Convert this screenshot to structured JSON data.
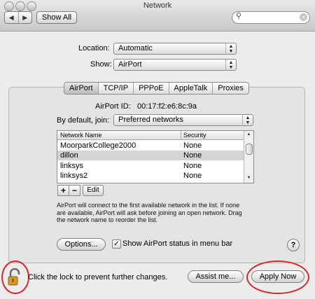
{
  "window": {
    "title": "Network"
  },
  "toolbar": {
    "back_fwd": [
      "◀",
      "▶"
    ],
    "show_all": "Show All",
    "search_placeholder": ""
  },
  "location": {
    "label": "Location:",
    "value": "Automatic"
  },
  "show": {
    "label": "Show:",
    "value": "AirPort"
  },
  "tabs": [
    "AirPort",
    "TCP/IP",
    "PPPoE",
    "AppleTalk",
    "Proxies"
  ],
  "airport": {
    "id_label": "AirPort ID:",
    "id_value": "00:17:f2:e6:8c:9a",
    "join_label": "By default, join:",
    "join_value": "Preferred networks",
    "table": {
      "headers": [
        "Network Name",
        "Security"
      ],
      "rows": [
        {
          "name": "MoorparkCollege2000",
          "security": "None"
        },
        {
          "name": "dillon",
          "security": "None"
        },
        {
          "name": "linksys",
          "security": "None"
        },
        {
          "name": "linksys2",
          "security": "None"
        }
      ]
    },
    "add_label": "+",
    "remove_label": "−",
    "edit_label": "Edit",
    "help_lines": [
      "AirPort will connect to the first available network in the list. If none",
      "are available, AirPort will ask before joining an open network. Drag",
      "the network name to reorder the list."
    ],
    "options_label": "Options...",
    "show_status_label": "Show AirPort status in menu bar",
    "show_status_checked": true
  },
  "footer": {
    "lock_text": "Click the lock to prevent further changes.",
    "assist_label": "Assist me...",
    "apply_label": "Apply Now"
  },
  "icons": {
    "search": "magnifier-icon",
    "help": "?",
    "lock": "open-lock-icon"
  },
  "colors": {
    "annotation_ring": "#d9262a"
  }
}
